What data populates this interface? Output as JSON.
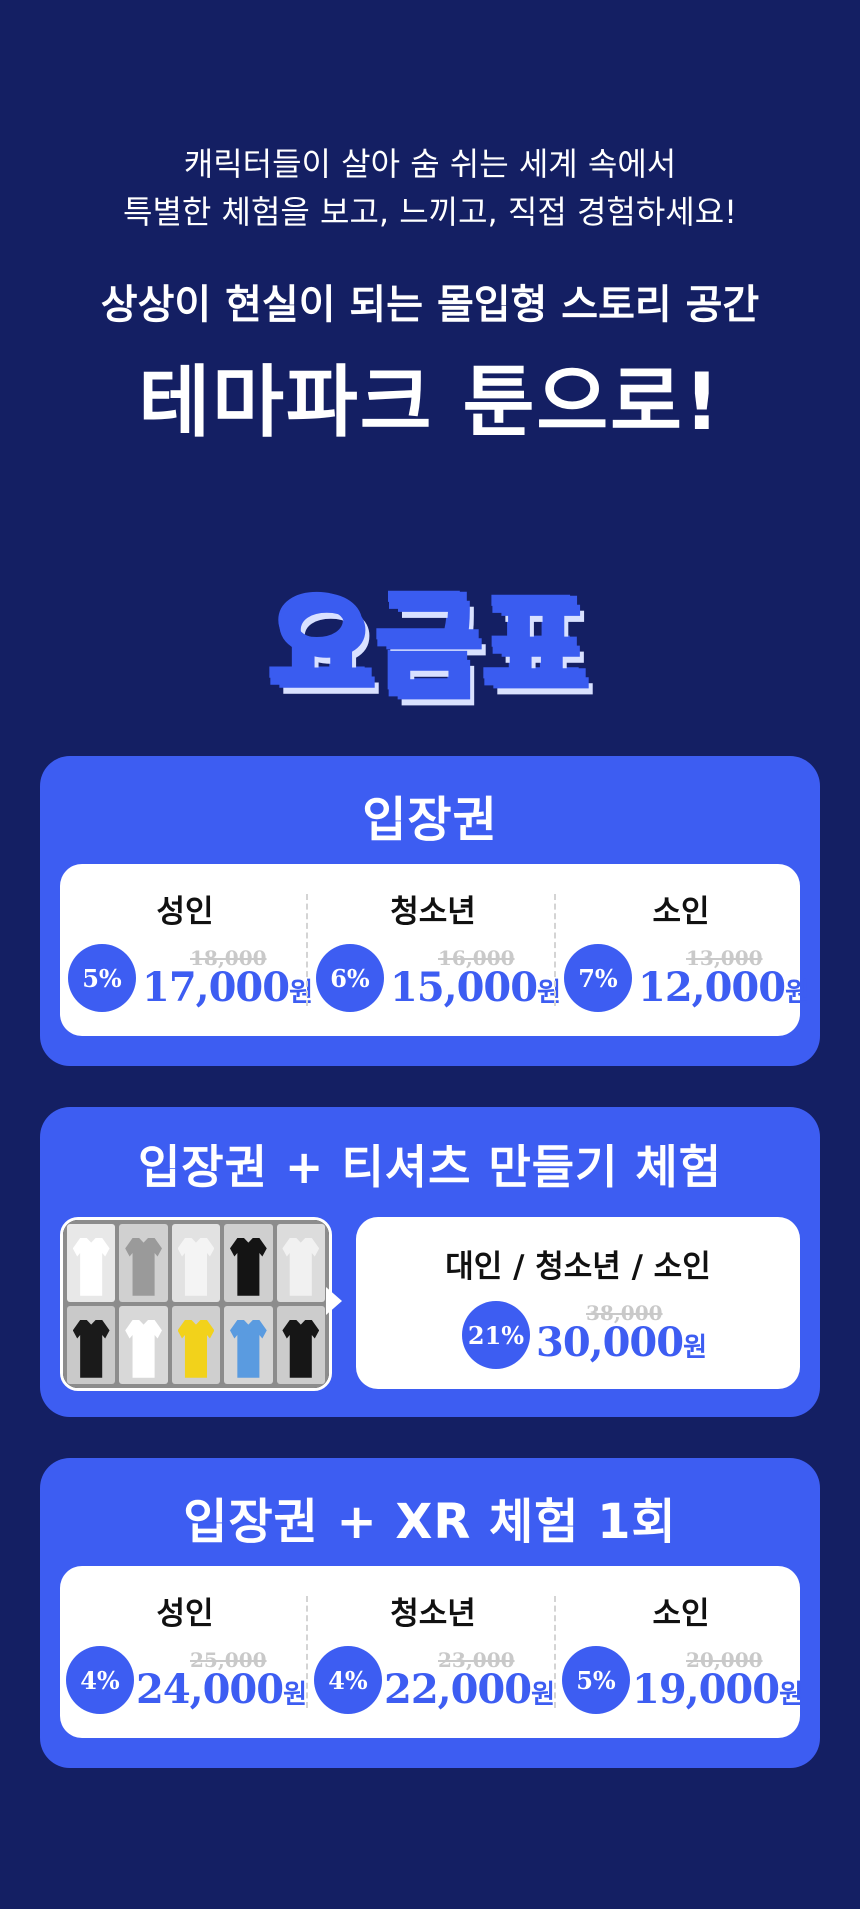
{
  "intro": {
    "line1": "캐릭터들이 살아 숨 쉬는 세계 속에서",
    "line2": "특별한 체험을 보고, 느끼고, 직접 경험하세요!",
    "tagline": "상상이 현실이 되는 몰입형 스토리 공간",
    "headline": "테마파크 툰으로!"
  },
  "pricing_title": "요금표",
  "colors": {
    "background": "#141f63",
    "accent": "#3d5df2",
    "panel": "#ffffff"
  },
  "sections": [
    {
      "title": "입장권",
      "tiers": [
        {
          "label": "성인",
          "discount": "5%",
          "original": "18,000",
          "price": "17,000",
          "unit": "원"
        },
        {
          "label": "청소년",
          "discount": "6%",
          "original": "16,000",
          "price": "15,000",
          "unit": "원"
        },
        {
          "label": "소인",
          "discount": "7%",
          "original": "13,000",
          "price": "12,000",
          "unit": "원"
        }
      ]
    },
    {
      "title": "입장권 + 티셔츠 만들기 체험",
      "image": "t-shirt-display-photo",
      "tiers": [
        {
          "label": "대인 / 청소년 / 소인",
          "discount": "21%",
          "original": "38,000",
          "price": "30,000",
          "unit": "원"
        }
      ]
    },
    {
      "title": "입장권 + XR 체험 1회",
      "tiers": [
        {
          "label": "성인",
          "discount": "4%",
          "original": "25,000",
          "price": "24,000",
          "unit": "원"
        },
        {
          "label": "청소년",
          "discount": "4%",
          "original": "23,000",
          "price": "22,000",
          "unit": "원"
        },
        {
          "label": "소인",
          "discount": "5%",
          "original": "20,000",
          "price": "19,000",
          "unit": "원"
        }
      ]
    }
  ]
}
